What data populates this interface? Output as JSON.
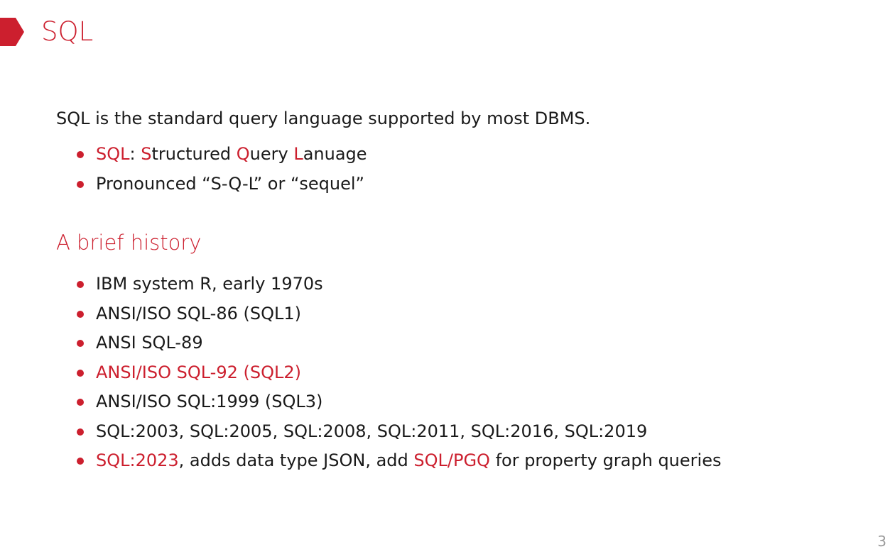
{
  "slide": {
    "title": "SQL",
    "page_number": "3",
    "accent_color": "#cc1f2e"
  },
  "intro": {
    "text": "SQL is the standard query language supported by most DBMS."
  },
  "definition_bullets": [
    {
      "parts": [
        {
          "text": "SQL",
          "accent": true
        },
        {
          "text": ": ",
          "accent": false
        },
        {
          "text": "S",
          "accent": true
        },
        {
          "text": "tructured ",
          "accent": false
        },
        {
          "text": "Q",
          "accent": true
        },
        {
          "text": "uery ",
          "accent": false
        },
        {
          "text": "L",
          "accent": true
        },
        {
          "text": "anuage",
          "accent": false
        }
      ]
    },
    {
      "parts": [
        {
          "text": "Pronounced “S-Q-L” or “sequel”",
          "accent": false
        }
      ]
    }
  ],
  "history": {
    "heading": "A brief history",
    "items": [
      {
        "parts": [
          {
            "text": "IBM system R, early 1970s",
            "accent": false
          }
        ]
      },
      {
        "parts": [
          {
            "text": "ANSI/ISO SQL-86 (SQL1)",
            "accent": false
          }
        ]
      },
      {
        "parts": [
          {
            "text": "ANSI SQL-89",
            "accent": false
          }
        ]
      },
      {
        "parts": [
          {
            "text": "ANSI/ISO SQL-92 (SQL2)",
            "accent": true
          }
        ]
      },
      {
        "parts": [
          {
            "text": "ANSI/ISO SQL:1999 (SQL3)",
            "accent": false
          }
        ]
      },
      {
        "parts": [
          {
            "text": "SQL:2003, SQL:2005, SQL:2008, SQL:2011, SQL:2016, SQL:2019",
            "accent": false
          }
        ]
      },
      {
        "parts": [
          {
            "text": "SQL:2023",
            "accent": true
          },
          {
            "text": ", adds data type JSON, add ",
            "accent": false
          },
          {
            "text": "SQL/PGQ",
            "accent": true
          },
          {
            "text": " for property graph queries",
            "accent": false
          }
        ]
      }
    ]
  }
}
